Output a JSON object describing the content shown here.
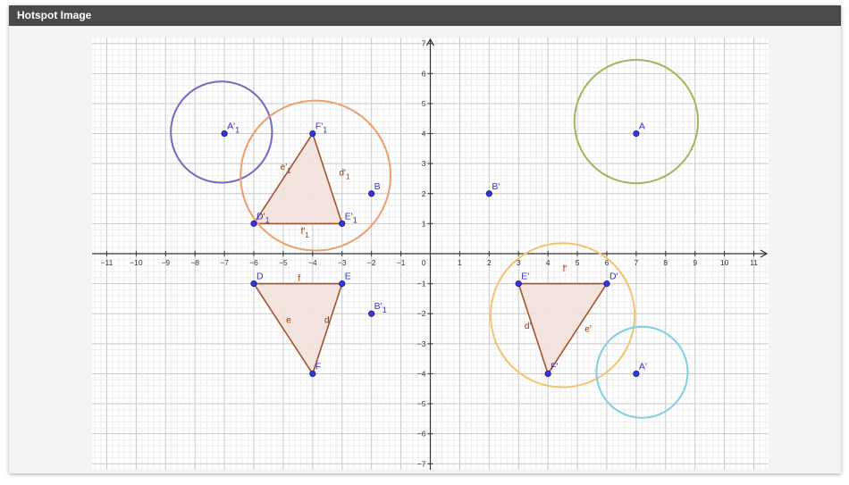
{
  "header": {
    "title": "Hotspot Image"
  },
  "graph": {
    "xmin": -11.5,
    "xmax": 11.5,
    "ymin": -7.2,
    "ymax": 7.2,
    "x_ticks": [
      -11,
      -10,
      -9,
      -8,
      -7,
      -6,
      -5,
      -4,
      -3,
      -2,
      -1,
      1,
      2,
      3,
      4,
      5,
      6,
      7,
      8,
      9,
      10,
      11
    ],
    "y_ticks": [
      -7,
      -6,
      -5,
      -4,
      -3,
      -2,
      -1,
      1,
      2,
      3,
      4,
      5,
      6,
      7
    ],
    "origin_label": "0",
    "colors": {
      "triangle_stroke": "#a0522d",
      "triangle_fill": "#f3e1dc",
      "point_fill": "#3333ee",
      "point_label": "#3333cc",
      "side_label": "#8b3a0f"
    },
    "circles": [
      {
        "cx": 7,
        "cy": 4.4,
        "r": 2.1,
        "color": "#9cb85c"
      },
      {
        "cx": -7.1,
        "cy": 4.05,
        "r": 1.72,
        "color": "#6f6abf"
      },
      {
        "cx": -3.9,
        "cy": 2.6,
        "r": 2.55,
        "color": "#eb9f6c"
      },
      {
        "cx": 4.5,
        "cy": -2.05,
        "r": 2.45,
        "color": "#f0c46a"
      },
      {
        "cx": 7.2,
        "cy": -3.95,
        "r": 1.55,
        "color": "#7fcfe0"
      }
    ],
    "triangles": [
      {
        "points": [
          [
            -6,
            1
          ],
          [
            -3,
            1
          ],
          [
            -4,
            4
          ]
        ]
      },
      {
        "points": [
          [
            -6,
            -1
          ],
          [
            -3,
            -1
          ],
          [
            -4,
            -4
          ]
        ]
      },
      {
        "points": [
          [
            3,
            -1
          ],
          [
            6,
            -1
          ],
          [
            4,
            -4
          ]
        ]
      }
    ],
    "points": [
      {
        "x": 7,
        "y": 4,
        "label": "A",
        "sub": ""
      },
      {
        "x": -7,
        "y": 4,
        "label": "A'",
        "sub": "1"
      },
      {
        "x": -2,
        "y": 2,
        "label": "B",
        "sub": ""
      },
      {
        "x": 2,
        "y": 2,
        "label": "B'",
        "sub": ""
      },
      {
        "x": -2,
        "y": -2,
        "label": "B'",
        "sub": "1"
      },
      {
        "x": 7,
        "y": -4,
        "label": "A'",
        "sub": ""
      },
      {
        "x": -4,
        "y": 4,
        "label": "F'",
        "sub": "1"
      },
      {
        "x": -6,
        "y": 1,
        "label": "D'",
        "sub": "1"
      },
      {
        "x": -3,
        "y": 1,
        "label": "E'",
        "sub": "1"
      },
      {
        "x": -6,
        "y": -1,
        "label": "D",
        "sub": ""
      },
      {
        "x": -3,
        "y": -1,
        "label": "E",
        "sub": ""
      },
      {
        "x": -4,
        "y": -4,
        "label": "F",
        "sub": ""
      },
      {
        "x": 3,
        "y": -1,
        "label": "E'",
        "sub": ""
      },
      {
        "x": 6,
        "y": -1,
        "label": "D'",
        "sub": ""
      },
      {
        "x": 4,
        "y": -4,
        "label": "F'",
        "sub": ""
      }
    ],
    "side_labels": [
      {
        "x": -5.1,
        "y": 2.8,
        "label": "e'",
        "sub": "1"
      },
      {
        "x": -3.1,
        "y": 2.6,
        "label": "d'",
        "sub": "1"
      },
      {
        "x": -4.4,
        "y": 0.65,
        "label": "f'",
        "sub": "1"
      },
      {
        "x": -4.5,
        "y": -0.9,
        "label": "f",
        "sub": ""
      },
      {
        "x": -4.9,
        "y": -2.3,
        "label": "e",
        "sub": ""
      },
      {
        "x": -3.6,
        "y": -2.3,
        "label": "d",
        "sub": ""
      },
      {
        "x": 4.5,
        "y": -0.6,
        "label": "f'",
        "sub": ""
      },
      {
        "x": 3.2,
        "y": -2.5,
        "label": "d'",
        "sub": ""
      },
      {
        "x": 5.25,
        "y": -2.6,
        "label": "e'",
        "sub": ""
      }
    ]
  }
}
